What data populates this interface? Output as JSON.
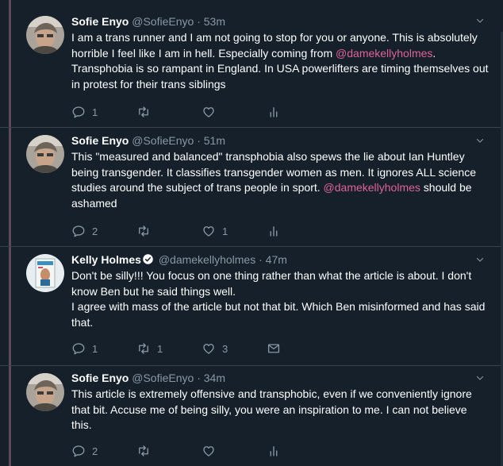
{
  "tweets": [
    {
      "name": "Sofie Enyo",
      "handle": "@SofieEnyo",
      "separator": "·",
      "time": "53m",
      "text_parts": [
        "I am a trans runner and I am not going to stop for you or anyone. This is absolutely horrible I feel like I am in hell. Especially coming from ",
        "@damekellyholmes",
        ". Transphobia is so rampant in England. In USA powerlifters are timing themselves out in protest for their trans siblings"
      ],
      "replies": "1",
      "retweets": "",
      "likes": ""
    },
    {
      "name": "Sofie Enyo",
      "handle": "@SofieEnyo",
      "separator": "·",
      "time": "51m",
      "text_parts": [
        "This \"measured and balanced\" transphobia also spews the lie about Ian Huntley being transgender. It classifies transgender women as men. It ignores ALL science studies around the subject of trans people in sport. ",
        "@damekellyholmes",
        " should be ashamed"
      ],
      "replies": "2",
      "retweets": "",
      "likes": "1"
    },
    {
      "name": "Kelly Holmes",
      "handle": "@damekellyholmes",
      "separator": "·",
      "time": "47m",
      "text_parts": [
        "Don't be silly!!! You focus on one thing rather than what the article is about. I don't know Ben but he said things well.",
        "I agree with mass of the article but not that bit. Which Ben misinformed and has said that."
      ],
      "replies": "1",
      "retweets": "1",
      "likes": "3"
    },
    {
      "name": "Sofie Enyo",
      "handle": "@SofieEnyo",
      "separator": "·",
      "time": "34m",
      "text_parts": [
        "This article is extremely offensive and transphobic, even if we conveniently ignore that bit. Accuse me of being silly, you were an inspiration to me. I can not believe this."
      ],
      "replies": "2",
      "retweets": "",
      "likes": ""
    }
  ],
  "colors": {
    "background": "#15202b",
    "mention": "#e0629a",
    "muted": "#8899a6",
    "verified": "#ffffff"
  }
}
